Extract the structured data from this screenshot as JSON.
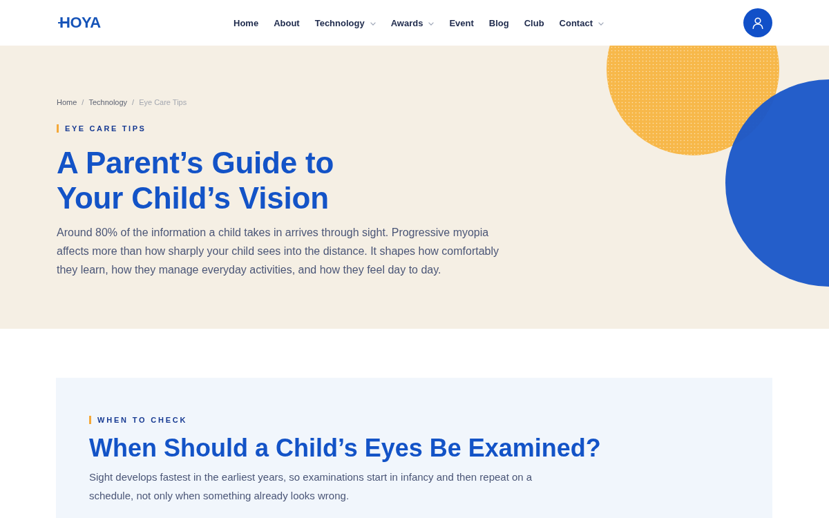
{
  "header": {
    "logo": "HOYA",
    "nav": [
      {
        "label": "Home",
        "dropdown": false
      },
      {
        "label": "About",
        "dropdown": false
      },
      {
        "label": "Technology",
        "dropdown": true
      },
      {
        "label": "Awards",
        "dropdown": true
      },
      {
        "label": "Event",
        "dropdown": false
      },
      {
        "label": "Blog",
        "dropdown": false
      },
      {
        "label": "Club",
        "dropdown": false
      },
      {
        "label": "Contact",
        "dropdown": true
      }
    ]
  },
  "hero": {
    "breadcrumb": [
      {
        "label": "Home",
        "current": false
      },
      {
        "label": "Technology",
        "current": false
      },
      {
        "label": "Eye Care Tips",
        "current": true
      }
    ],
    "breadcrumb_separators": [
      "/",
      "/"
    ],
    "eyebrow": "EYE CARE TIPS",
    "title": "A Parent’s Guide to Your Child’s Vision",
    "intro": "Around 80% of the information a child takes in arrives through sight. Progressive myopia affects more than how sharply your child sees into the distance. It shapes how comfortably they learn, how they manage everyday activities, and how they feel day to day."
  },
  "section": {
    "eyebrow": "WHEN TO CHECK",
    "title": "When Should a Child’s Eyes Be Examined?",
    "text": "Sight develops fastest in the earliest years, so examinations start in infancy and then repeat on a schedule, not only when something already looks wrong."
  }
}
